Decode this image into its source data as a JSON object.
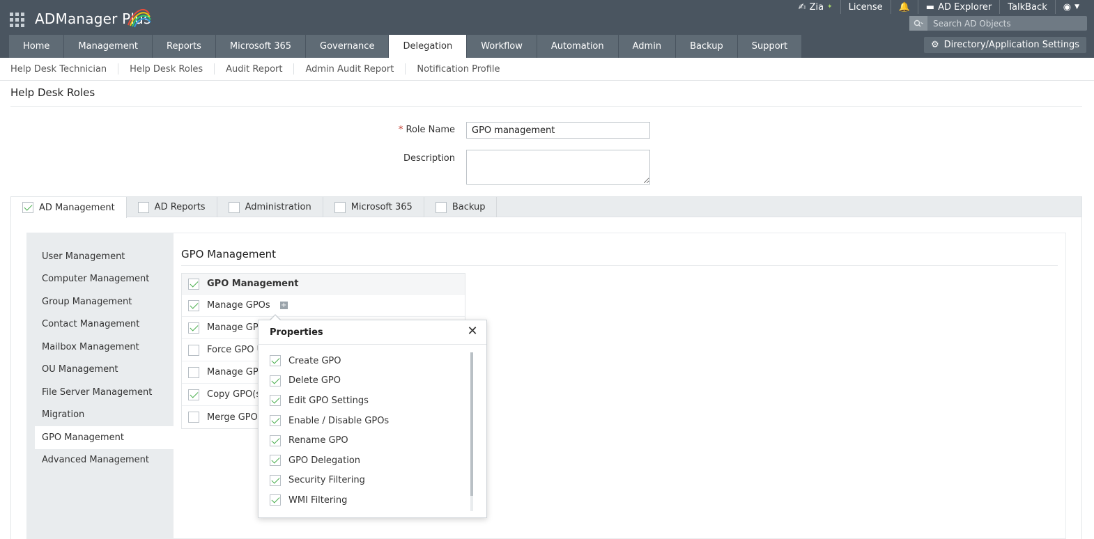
{
  "app": {
    "title": "ADManager Plus"
  },
  "top_links": {
    "zia": "Zia",
    "license": "License",
    "ad_explorer": "AD Explorer",
    "talkback": "TalkBack"
  },
  "search": {
    "placeholder": "Search AD Objects"
  },
  "main_nav": {
    "tabs": [
      "Home",
      "Management",
      "Reports",
      "Microsoft 365",
      "Governance",
      "Delegation",
      "Workflow",
      "Automation",
      "Admin",
      "Backup",
      "Support"
    ],
    "active": "Delegation"
  },
  "settings_button": "Directory/Application Settings",
  "sub_nav": [
    "Help Desk Technician",
    "Help Desk Roles",
    "Audit Report",
    "Admin Audit Report",
    "Notification Profile"
  ],
  "page": {
    "title": "Help Desk Roles",
    "required_mark": "*",
    "role_name_label": "Role Name",
    "role_name_value": "GPO management",
    "description_label": "Description"
  },
  "module_tabs": [
    {
      "label": "AD Management",
      "checked": true,
      "active": true
    },
    {
      "label": "AD Reports",
      "checked": false
    },
    {
      "label": "Administration",
      "checked": false
    },
    {
      "label": "Microsoft 365",
      "checked": false
    },
    {
      "label": "Backup",
      "checked": false
    }
  ],
  "left_menu": {
    "items": [
      "User Management",
      "Computer Management",
      "Group Management",
      "Contact Management",
      "Mailbox Management",
      "OU Management",
      "File Server Management",
      "Migration",
      "GPO Management",
      "Advanced Management"
    ],
    "active": "GPO Management"
  },
  "section": {
    "title": "GPO Management",
    "header": {
      "label": "GPO Management",
      "checked": true
    },
    "rows": [
      {
        "label": "Manage GPOs",
        "checked": true
      },
      {
        "label": "Manage GPC",
        "checked": true
      },
      {
        "label": "Force GPO U",
        "checked": false
      },
      {
        "label": "Manage GPC",
        "checked": false
      },
      {
        "label": "Copy GPO(s",
        "checked": true
      },
      {
        "label": "Merge GPOs",
        "checked": false
      }
    ]
  },
  "popup": {
    "title": "Properties",
    "items": [
      {
        "label": "Create GPO",
        "checked": true
      },
      {
        "label": "Delete GPO",
        "checked": true
      },
      {
        "label": "Edit GPO Settings",
        "checked": true
      },
      {
        "label": "Enable / Disable GPOs",
        "checked": true
      },
      {
        "label": "Rename GPO",
        "checked": true
      },
      {
        "label": "GPO Delegation",
        "checked": true
      },
      {
        "label": "Security Filtering",
        "checked": true
      },
      {
        "label": "WMI Filtering",
        "checked": true
      }
    ]
  },
  "colors": {
    "header_bg": "#4a5560",
    "tab_bg": "#5f6b75",
    "check_green": "#4caf50",
    "panel_bg": "#e9ecee"
  }
}
